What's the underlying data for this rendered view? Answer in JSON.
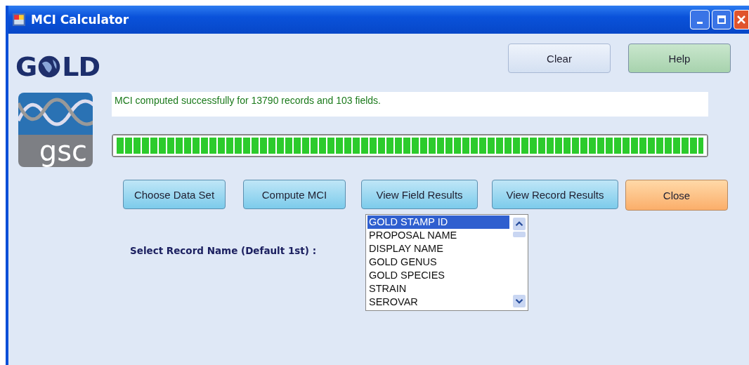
{
  "window": {
    "title": "MCI Calculator"
  },
  "logos": {
    "gold": {
      "left": "G",
      "right": "LD"
    },
    "gsc": {
      "text": "gsc"
    }
  },
  "top_buttons": [
    {
      "label": "Clear",
      "kind": "plain"
    },
    {
      "label": "Help",
      "kind": "help"
    }
  ],
  "status": {
    "message": "MCI computed successfully for 13790 records and 103 fields."
  },
  "progress": {
    "level": 1
  },
  "action_buttons": [
    {
      "label": "Choose Data Set",
      "kind": "action"
    },
    {
      "label": "Compute MCI",
      "kind": "action"
    },
    {
      "label": "View Field Results",
      "kind": "action"
    },
    {
      "label": "View Record Results",
      "kind": "action"
    },
    {
      "label": "Close",
      "kind": "close"
    }
  ],
  "record_select": {
    "label": "Select Record Name (Default 1st) :",
    "items": [
      {
        "label": "GOLD STAMP ID",
        "selected": true
      },
      {
        "label": "PROPOSAL NAME",
        "selected": false
      },
      {
        "label": "DISPLAY NAME",
        "selected": false
      },
      {
        "label": "GOLD GENUS",
        "selected": false
      },
      {
        "label": "GOLD SPECIES",
        "selected": false
      },
      {
        "label": "STRAIN",
        "selected": false
      },
      {
        "label": "SEROVAR",
        "selected": false
      }
    ]
  }
}
